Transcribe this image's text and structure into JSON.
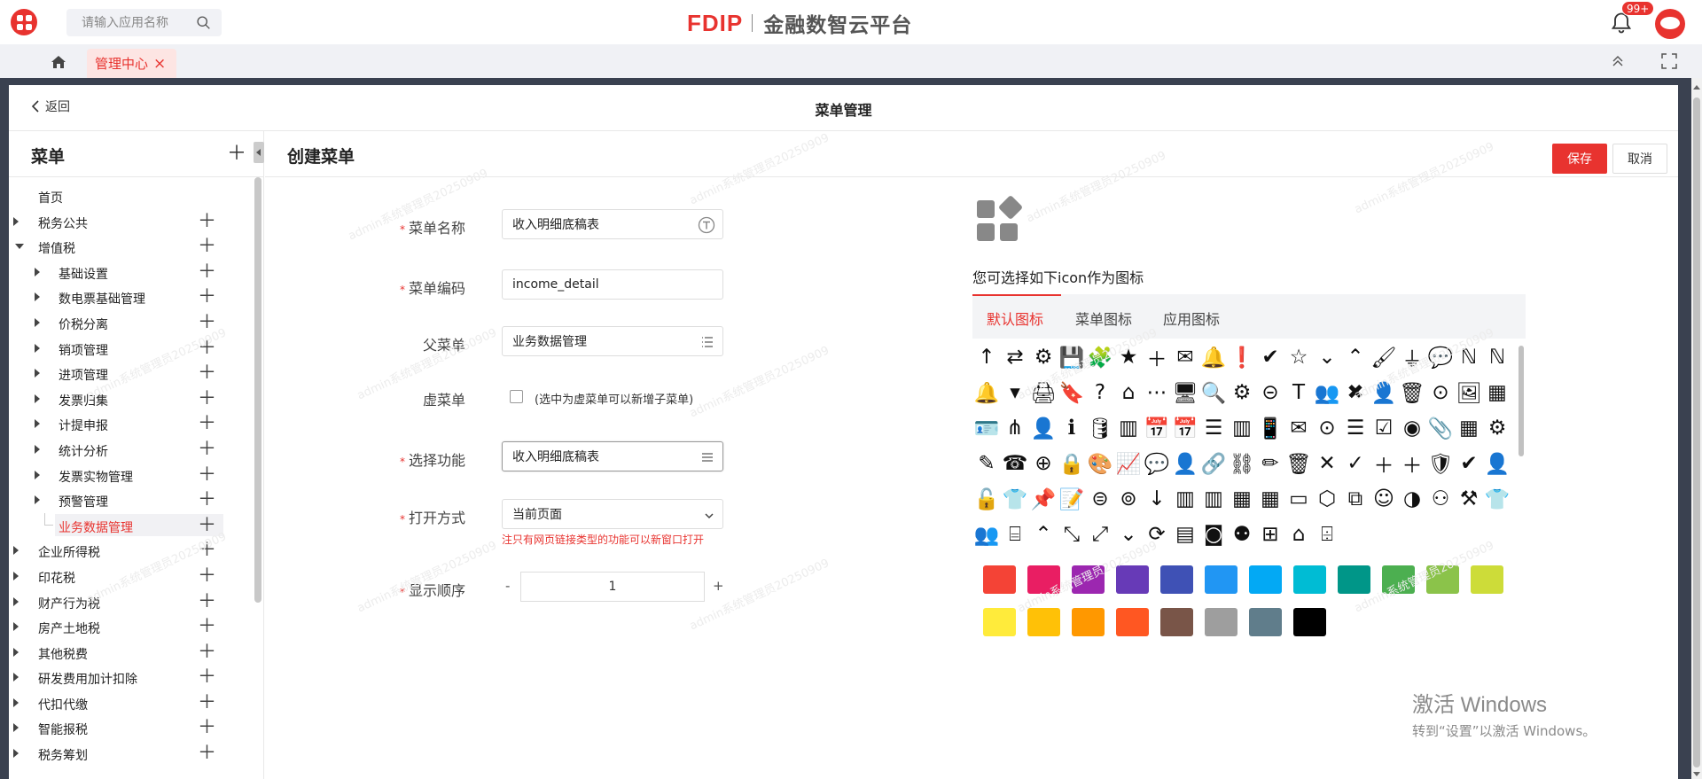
{
  "topbar": {
    "search_placeholder": "请输入应用名称",
    "brand_logo": "FDIP",
    "brand_name": "金融数智云平台",
    "notification_count": "99+"
  },
  "tabs": {
    "active_label": "管理中心",
    "close_glyph": "×"
  },
  "page": {
    "back_label": "返回",
    "title": "菜单管理"
  },
  "tree": {
    "title": "菜单",
    "items": [
      {
        "label": "首页",
        "level": 1,
        "caret": "none"
      },
      {
        "label": "税务公共",
        "level": 1,
        "caret": "closed"
      },
      {
        "label": "增值税",
        "level": 1,
        "caret": "open"
      },
      {
        "label": "基础设置",
        "level": 2,
        "caret": "closed"
      },
      {
        "label": "数电票基础管理",
        "level": 2,
        "caret": "closed"
      },
      {
        "label": "价税分离",
        "level": 2,
        "caret": "closed"
      },
      {
        "label": "销项管理",
        "level": 2,
        "caret": "closed"
      },
      {
        "label": "进项管理",
        "level": 2,
        "caret": "closed"
      },
      {
        "label": "发票归集",
        "level": 2,
        "caret": "closed"
      },
      {
        "label": "计提申报",
        "level": 2,
        "caret": "closed"
      },
      {
        "label": "统计分析",
        "level": 2,
        "caret": "closed"
      },
      {
        "label": "发票实物管理",
        "level": 2,
        "caret": "closed"
      },
      {
        "label": "预警管理",
        "level": 2,
        "caret": "closed"
      },
      {
        "label": "业务数据管理",
        "level": 2,
        "caret": "none",
        "selected": true
      },
      {
        "label": "企业所得税",
        "level": 1,
        "caret": "closed"
      },
      {
        "label": "印花税",
        "level": 1,
        "caret": "closed"
      },
      {
        "label": "财产行为税",
        "level": 1,
        "caret": "closed"
      },
      {
        "label": "房产土地税",
        "level": 1,
        "caret": "closed"
      },
      {
        "label": "其他税费",
        "level": 1,
        "caret": "closed"
      },
      {
        "label": "研发费用加计扣除",
        "level": 1,
        "caret": "closed"
      },
      {
        "label": "代扣代缴",
        "level": 1,
        "caret": "closed"
      },
      {
        "label": "智能报税",
        "level": 1,
        "caret": "closed"
      },
      {
        "label": "税务筹划",
        "level": 1,
        "caret": "closed"
      }
    ]
  },
  "form": {
    "title": "创建菜单",
    "save_label": "保存",
    "cancel_label": "取消",
    "name_label": "菜单名称",
    "name_value": "收入明细底稿表",
    "code_label": "菜单编码",
    "code_value": "income_detail",
    "parent_label": "父菜单",
    "parent_value": "业务数据管理",
    "virtual_label": "虚菜单",
    "virtual_hint": "(选中为虚菜单可以新增子菜单)",
    "function_label": "选择功能",
    "function_value": "收入明细底稿表",
    "open_label": "打开方式",
    "open_value": "当前页面",
    "open_hint": "注只有网页链接类型的功能可以新窗口打开",
    "order_label": "显示顺序",
    "order_minus": "-",
    "order_value": "1",
    "order_plus": "+"
  },
  "picker": {
    "hint": "您可选择如下icon作为图标",
    "tabs": [
      "默认图标",
      "菜单图标",
      "应用图标"
    ],
    "icons": [
      "↑",
      "⇄",
      "⚙",
      "💾",
      "🧩",
      "★",
      "＋",
      "✉",
      "🔔",
      "❗",
      "✔",
      "☆",
      "⌄",
      "⌃",
      "🖌",
      "⏚",
      "💬",
      "ℕ",
      "ℕ",
      "🔔",
      "▾",
      "🖨",
      "🔖",
      "?",
      "⌂",
      "⋯",
      "🖥",
      "🔍",
      "⚙",
      "⊝",
      "T",
      "👥",
      "✖",
      "👤",
      "🗑",
      "⊙",
      "🖼",
      "▦",
      "🪪",
      "⋔",
      "👤",
      "ℹ",
      "🛢",
      "▥",
      "📅",
      "📅",
      "☰",
      "▥",
      "📱",
      "✉",
      "⊙",
      "☰",
      "☑",
      "◉",
      "📎",
      "▦",
      "⚙",
      "✎",
      "☎",
      "⊕",
      "🔒",
      "🎨",
      "📈",
      "💬",
      "👤",
      "🔗",
      "⛓",
      "✏",
      "🗑",
      "✕",
      "✓",
      "＋",
      "＋",
      "🛡",
      "✔",
      "👤",
      "🔓",
      "👕",
      "📌",
      "📝",
      "⊜",
      "⊚",
      "↓",
      "▥",
      "▥",
      "▦",
      "▦",
      "▭",
      "⬡",
      "⧉",
      "☺",
      "◑",
      "⚇",
      "⚒",
      "👕",
      "👥",
      "⌸",
      "⌃",
      "⤡",
      "⤢",
      "⌄",
      "⟳",
      "▤",
      "◙",
      "⚉",
      "⊞",
      "⌂",
      "⌹"
    ],
    "colors": [
      "#f44336",
      "#e91e63",
      "#9c27b0",
      "#673ab7",
      "#3f51b5",
      "#2196f3",
      "#03a9f4",
      "#00bcd4",
      "#009688",
      "#4caf50",
      "#8bc34a",
      "#cddc39",
      "#ffeb3b",
      "#ffc107",
      "#ff9800",
      "#ff5722",
      "#795548",
      "#9e9e9e",
      "#607d8b",
      "#000000"
    ]
  },
  "watermark_text": "admin系统管理员20250909",
  "activation": {
    "line1": "激活 Windows",
    "line2": "转到“设置”以激活 Windows。"
  }
}
